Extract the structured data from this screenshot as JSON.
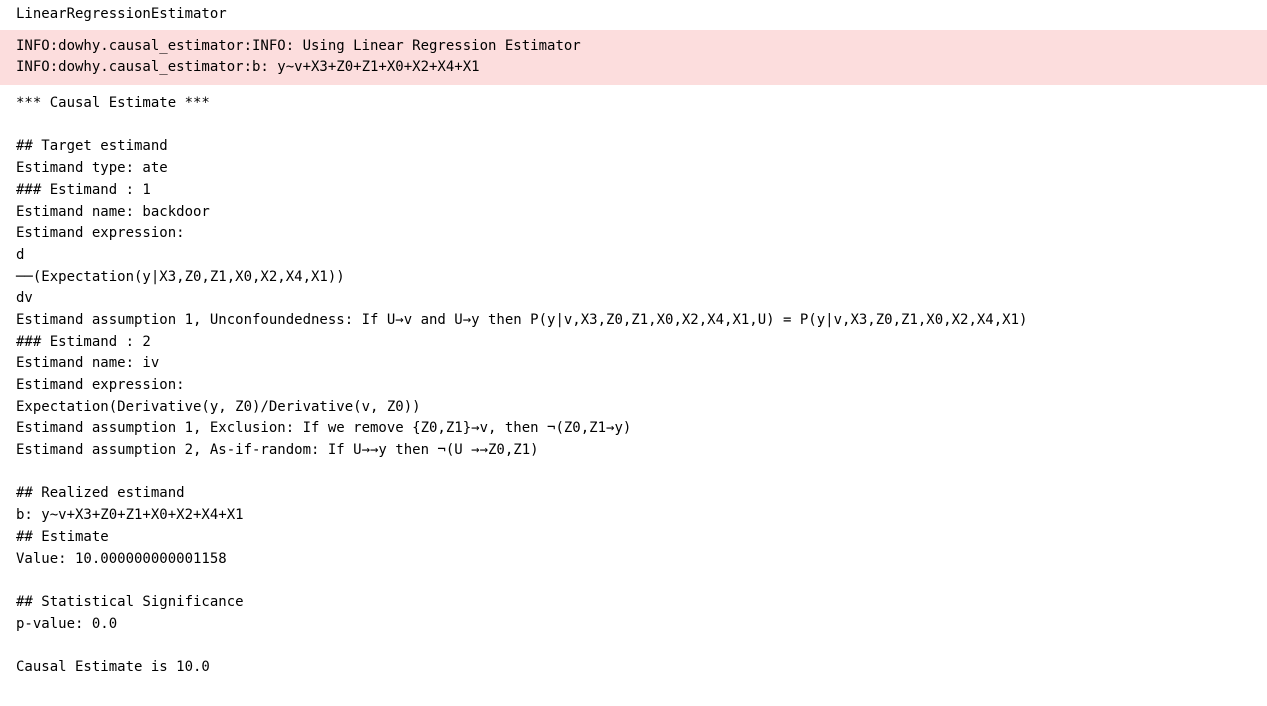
{
  "title": "LinearRegressionEstimator",
  "info": {
    "line1": "INFO:dowhy.causal_estimator:INFO: Using Linear Regression Estimator",
    "line2": "INFO:dowhy.causal_estimator:b: y~v+X3+Z0+Z1+X0+X2+X4+X1"
  },
  "output": {
    "header": "*** Causal Estimate ***",
    "target_header": "## Target estimand",
    "estimand_type": "Estimand type: ate",
    "estimand1_header": "### Estimand : 1",
    "estimand1_name": "Estimand name: backdoor",
    "estimand1_expr_label": "Estimand expression:",
    "estimand1_expr_d": "d",
    "estimand1_expr_frac": "──(Expectation(y|X3,Z0,Z1,X0,X2,X4,X1))",
    "estimand1_expr_dv": "dv",
    "estimand1_assumption": "Estimand assumption 1, Unconfoundedness: If U→v and U→y then P(y|v,X3,Z0,Z1,X0,X2,X4,X1,U) = P(y|v,X3,Z0,Z1,X0,X2,X4,X1)",
    "estimand2_header": "### Estimand : 2",
    "estimand2_name": "Estimand name: iv",
    "estimand2_expr_label": "Estimand expression:",
    "estimand2_expr": "Expectation(Derivative(y, Z0)/Derivative(v, Z0))",
    "estimand2_assumption1": "Estimand assumption 1, Exclusion: If we remove {Z0,Z1}→v, then ¬(Z0,Z1→y)",
    "estimand2_assumption2": "Estimand assumption 2, As-if-random: If U→→y then ¬(U →→Z0,Z1)",
    "realized_header": "## Realized estimand",
    "realized_expr": "b: y~v+X3+Z0+Z1+X0+X2+X4+X1",
    "estimate_header": "## Estimate",
    "estimate_value": "Value: 10.000000000001158",
    "stat_sig_header": "## Statistical Significance",
    "pvalue": "p-value: 0.0",
    "final": "Causal Estimate is 10.0"
  }
}
